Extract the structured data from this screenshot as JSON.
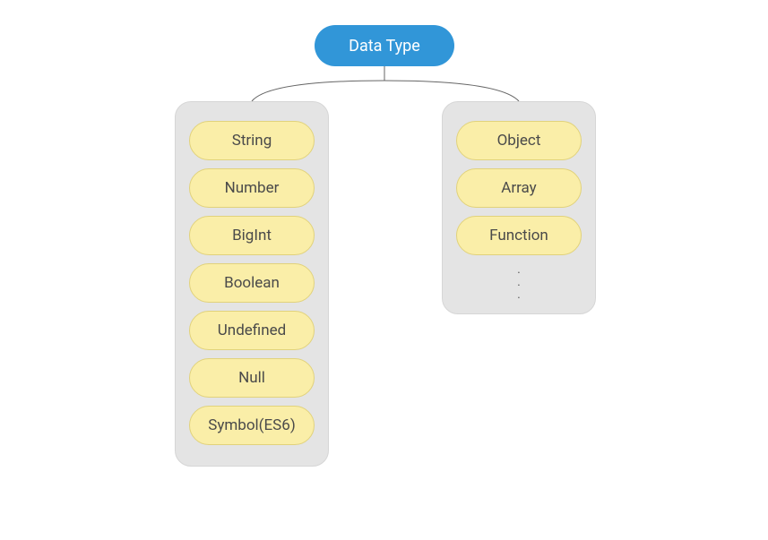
{
  "root": {
    "label": "Data Type"
  },
  "groups": {
    "primitive": {
      "items": [
        {
          "label": "String"
        },
        {
          "label": "Number"
        },
        {
          "label": "BigInt"
        },
        {
          "label": "Boolean"
        },
        {
          "label": "Undefined"
        },
        {
          "label": "Null"
        },
        {
          "label": "Symbol(ES6)"
        }
      ]
    },
    "reference": {
      "items": [
        {
          "label": "Object"
        },
        {
          "label": "Array"
        },
        {
          "label": "Function"
        }
      ],
      "ellipsis": true
    }
  }
}
